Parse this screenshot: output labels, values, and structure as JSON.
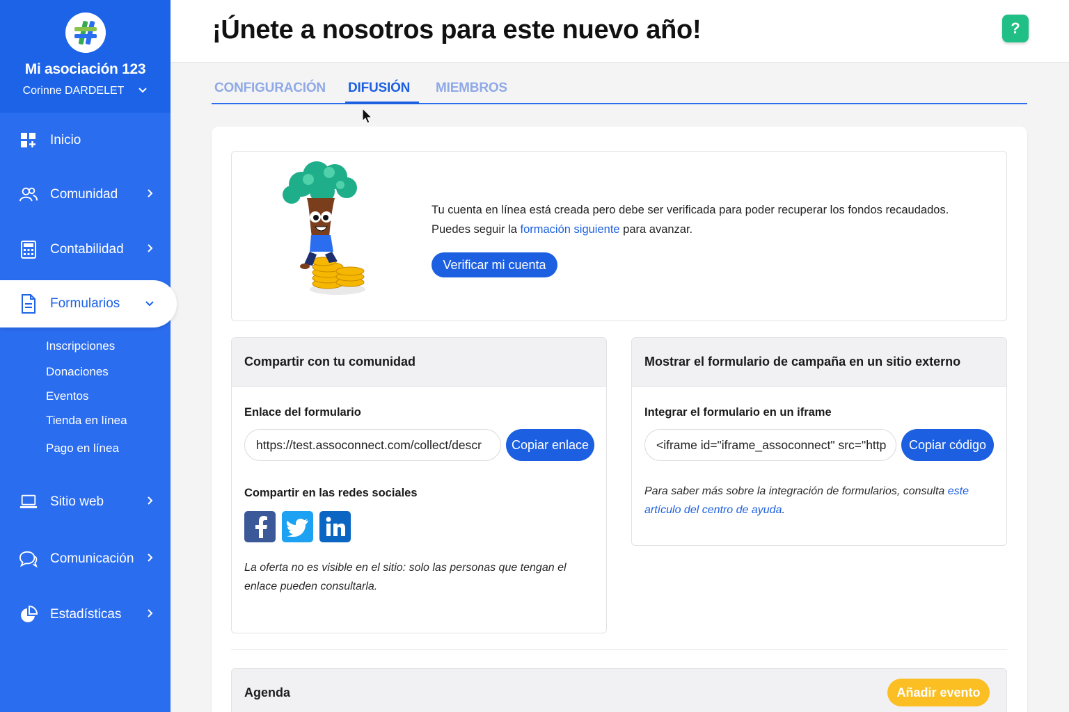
{
  "sidebar": {
    "org_name": "Mi asociación 123",
    "user_name": "Corinne DARDELET",
    "items": [
      {
        "label": "Inicio",
        "icon": "dashboard-icon"
      },
      {
        "label": "Comunidad",
        "icon": "community-icon"
      },
      {
        "label": "Contabilidad",
        "icon": "calculator-icon"
      },
      {
        "label": "Formularios",
        "icon": "document-icon",
        "active": true
      },
      {
        "label": "Sitio web",
        "icon": "laptop-icon"
      },
      {
        "label": "Comunicación",
        "icon": "chat-icon"
      },
      {
        "label": "Estadísticas",
        "icon": "chart-icon"
      }
    ],
    "subitems": [
      "Inscripciones",
      "Donaciones",
      "Eventos",
      "Tienda en línea",
      "Pago en línea"
    ]
  },
  "header": {
    "title": "¡Únete a nosotros para este nuevo año!",
    "help_label": "?"
  },
  "tabs": [
    {
      "label": "CONFIGURACIÓN"
    },
    {
      "label": "DIFUSIÓN",
      "active": true
    },
    {
      "label": "MIEMBROS"
    }
  ],
  "verify": {
    "line1": "Tu cuenta en línea está creada pero debe ser verificada para poder recuperar los fondos recaudados.",
    "line2_before": "Puedes seguir la ",
    "line2_link": "formación siguiente",
    "line2_after": " para avanzar.",
    "button": "Verificar mi cuenta"
  },
  "share": {
    "title": "Compartir con tu comunidad",
    "link_label": "Enlace del formulario",
    "link_value": "https://test.assoconnect.com/collect/descr",
    "copy_button": "Copiar enlace",
    "social_label": "Compartir en las redes sociales",
    "social": [
      "facebook-icon",
      "twitter-icon",
      "linkedin-icon"
    ],
    "note_line1": "La oferta no es visible en el sitio: solo las personas que tengan el",
    "note_line2": "enlace pueden consultarla."
  },
  "embed": {
    "title": "Mostrar el formulario de campaña en un sitio externo",
    "iframe_label": "Integrar el formulario en un iframe",
    "iframe_value": "<iframe id=\"iframe_assoconnect\" src=\"http",
    "copy_button": "Copiar código",
    "note_before": "Para saber más sobre la integración de formularios, consulta ",
    "note_link1": "este",
    "note_link2": "artículo del centro de ayuda",
    "note_after": "."
  },
  "agenda": {
    "title": "Agenda",
    "add_button": "Añadir evento"
  },
  "colors": {
    "sidebar_blue": "#2b6def",
    "primary": "#1c5fe0",
    "help_green": "#1fbf85",
    "add_event_yellow": "#fbbf24",
    "facebook": "#3b5998",
    "twitter": "#1da1f2",
    "linkedin": "#0a66c2"
  }
}
